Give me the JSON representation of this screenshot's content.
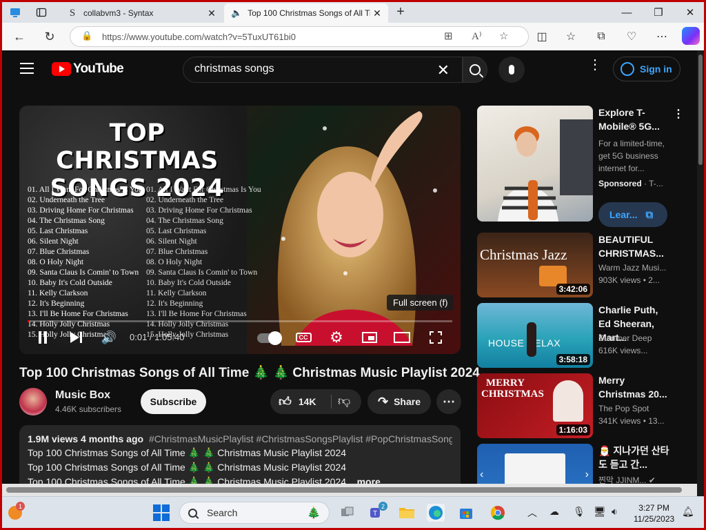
{
  "browser": {
    "tabs": [
      {
        "title": "collabvm3 - Syntax",
        "favicon": "s-icon"
      },
      {
        "title": "Top 100 Christmas Songs of All Time",
        "favicon": "youtube-icon"
      }
    ],
    "url": "https://www.youtube.com/watch?v=5TuxUT61bi0"
  },
  "youtube": {
    "logo_text": "YouTube",
    "search_value": "christmas songs",
    "sign_in": "Sign in"
  },
  "player": {
    "overlay_title_line1": "TOP CHRISTMAS",
    "overlay_title_line2": "SONGS 2024",
    "songs_col1": [
      "01. All I Want For Christmas Is You",
      "02. Underneath the Tree",
      "03. Driving Home For Christmas",
      "04. The Christmas Song",
      "05. Last Christmas",
      "06. Silent Night",
      "07. Blue Christmas",
      "08. O Holy Night",
      "09. Santa Claus Is Comin' to Town",
      "10. Baby It's Cold Outside",
      "11. Kelly Clarkson",
      "12. It's Beginning",
      "13. I'll Be Home For Christmas",
      "14. Holly Jolly Christmas",
      "15. Holly Jolly Christmas"
    ],
    "songs_col2": [
      "01. All I Want For Christmas Is You",
      "02. Underneath the Tree",
      "03. Driving Home For Christmas",
      "04. The Christmas Song",
      "05. Last Christmas",
      "06. Silent Night",
      "07. Blue Christmas",
      "08. O Holy Night",
      "09. Santa Claus Is Comin' to Town",
      "10. Baby It's Cold Outside",
      "11. Kelly Clarkson",
      "12. It's Beginning",
      "13. I'll Be Home For Christmas",
      "14. Holly Jolly Christmas",
      "15. Holly Jolly Christmas"
    ],
    "tooltip": "Full screen (f)",
    "current_time": "0:01",
    "duration": "1:05:40",
    "time_display": "0:01 / 1:05:40",
    "progress_fraction": 0.001,
    "cc_label": "CC"
  },
  "video": {
    "title": "Top 100 Christmas Songs of All Time 🎄 🎄 Christmas Music Playlist 2024",
    "channel_name": "Music Box",
    "subscribers": "4.46K subscribers",
    "subscribe_label": "Subscribe",
    "likes": "14K",
    "share_label": "Share",
    "views_date": "1.9M views  4 months ago",
    "hashtags": "#ChristmasMusicPlaylist #ChristmasSongsPlaylist #PopChristmasSongs",
    "desc_lines": [
      "Top 100 Christmas Songs of All Time 🎄 🎄 Christmas Music Playlist 2024",
      "Top 100 Christmas Songs of All Time 🎄 🎄 Christmas Music Playlist 2024",
      "Top 100 Christmas Songs of All Time 🎄 🎄 Christmas Music Playlist 2024"
    ],
    "more_label": "...more"
  },
  "sidebar": {
    "ad": {
      "title": "Explore T-Mobile® 5G...",
      "text": "For a limited-time, get 5G business internet for...",
      "sponsored": "Sponsored",
      "advertiser": "T-...",
      "cta": "Lear..."
    },
    "recommendations": [
      {
        "title": "BEAUTIFUL CHRISTMAS...",
        "channel": "Warm Jazz Musi...",
        "stats": "903K views  • 2...",
        "duration": "3:42:06",
        "thumb_text": "Christmas Jazz"
      },
      {
        "title": "Charlie Puth, Ed Sheeran, Mart...",
        "channel": "Summer Deep",
        "stats": "616K views...",
        "duration": "3:58:18",
        "thumb_text": "HOUSE  RELAX"
      },
      {
        "title": "Merry Christmas 20...",
        "channel": "The Pop Spot",
        "stats": "341K views  • 13...",
        "duration": "1:16:03",
        "thumb_text": "MERRY CHRISTMAS"
      },
      {
        "title": "🎅 지나가던 산타도 듣고 간...",
        "channel": "찐막 JJINM...",
        "stats": "",
        "duration": "",
        "thumb_text": ""
      }
    ]
  },
  "taskbar": {
    "search_label": "Search",
    "teams_badge": "2",
    "notif_badge": "1",
    "time": "3:27 PM",
    "date": "11/25/2023"
  }
}
